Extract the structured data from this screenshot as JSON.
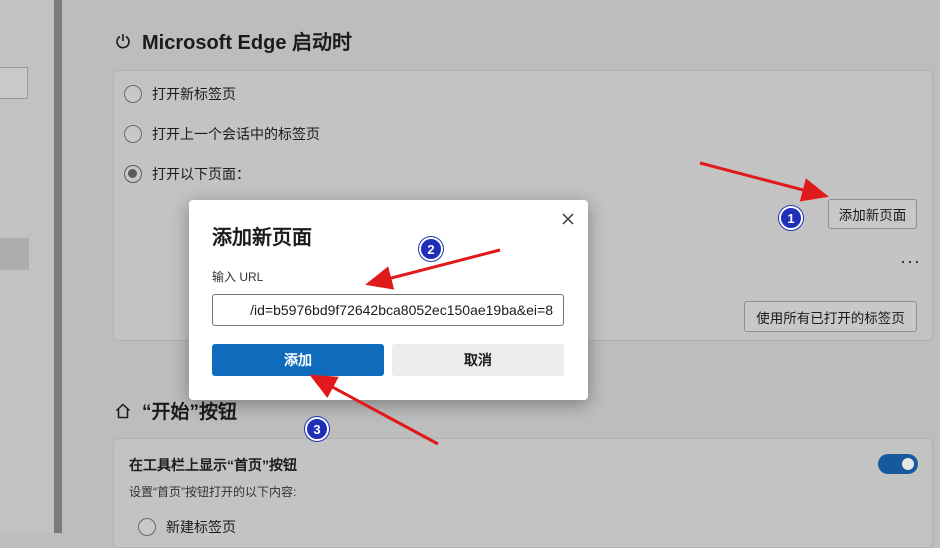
{
  "startup": {
    "title": "Microsoft Edge 启动时",
    "options": [
      {
        "label": "打开新标签页",
        "checked": false
      },
      {
        "label": "打开上一个会话中的标签页",
        "checked": false
      },
      {
        "label": "打开以下页面：",
        "checked": true
      }
    ],
    "add_page_button": "添加新页面",
    "more_label": "···",
    "use_open_tabs_button": "使用所有已打开的标签页"
  },
  "home_section": {
    "title": "“开始”按钮",
    "toggle_label": "在工具栏上显示“首页”按钮",
    "toggle_on": true,
    "description": "设置“首页”按钮打开的以下内容:",
    "option_new_tab": "新建标签页"
  },
  "dialog": {
    "title": "添加新页面",
    "url_label": "输入 URL",
    "url_value": "/id=b5976bd9f72642bca8052ec150ae19ba&ei=8",
    "add_button": "添加",
    "cancel_button": "取消"
  },
  "annotations": {
    "steps": [
      "1",
      "2",
      "3"
    ],
    "arrow_color": "#e0191b",
    "badge_color": "#1f2fb8"
  },
  "colors": {
    "accent": "#0f6cbd",
    "toggle_on": "#165a9b"
  }
}
